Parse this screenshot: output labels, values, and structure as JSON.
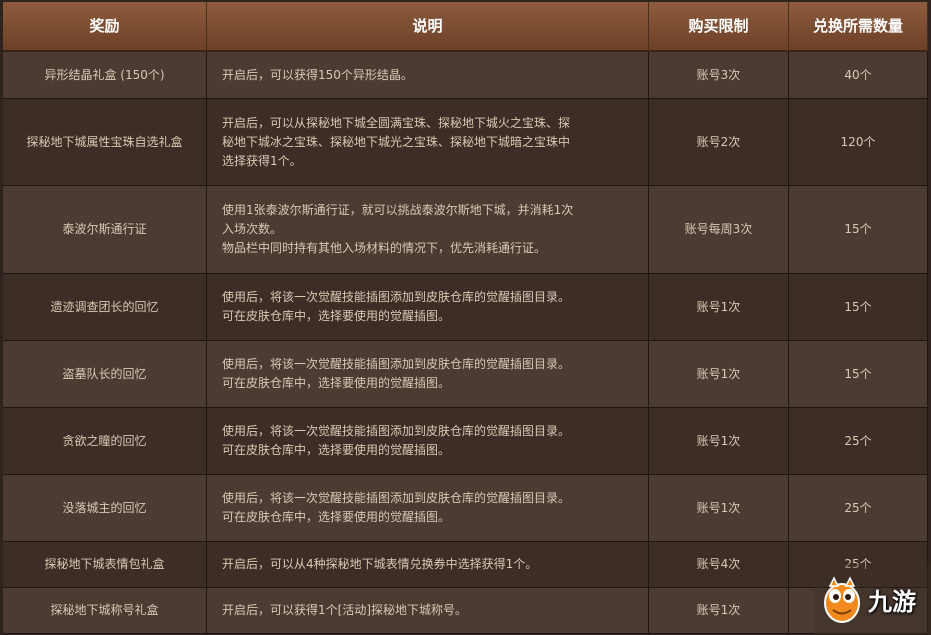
{
  "header": {
    "reward": "奖励",
    "description": "说明",
    "limit": "购买限制",
    "cost": "兑换所需数量"
  },
  "rows": [
    {
      "reward": "异形结晶礼盒 (150个)",
      "desc": [
        "开启后，可以获得150个异形结晶。"
      ],
      "limit": "账号3次",
      "cost": "40个"
    },
    {
      "reward": "探秘地下城属性宝珠自选礼盒",
      "desc": [
        "开启后，可以从探秘地下城全圆满宝珠、探秘地下城火之宝珠、探",
        "秘地下城冰之宝珠、探秘地下城光之宝珠、探秘地下城暗之宝珠中",
        "选择获得1个。"
      ],
      "limit": "账号2次",
      "cost": "120个"
    },
    {
      "reward": "泰波尔斯通行证",
      "desc": [
        "使用1张泰波尔斯通行证，就可以挑战泰波尔斯地下城，并消耗1次",
        "入场次数。",
        "物品栏中同时持有其他入场材料的情况下，优先消耗通行证。"
      ],
      "limit": "账号每周3次",
      "cost": "15个"
    },
    {
      "reward": "遗迹调查团长的回忆",
      "desc": [
        "使用后，将该一次觉醒技能插图添加到皮肤仓库的觉醒插图目录。",
        "可在皮肤仓库中，选择要使用的觉醒插图。"
      ],
      "limit": "账号1次",
      "cost": "15个"
    },
    {
      "reward": "盗墓队长的回忆",
      "desc": [
        "使用后，将该一次觉醒技能插图添加到皮肤仓库的觉醒插图目录。",
        "可在皮肤仓库中，选择要使用的觉醒插图。"
      ],
      "limit": "账号1次",
      "cost": "15个"
    },
    {
      "reward": "贪欲之瞳的回忆",
      "desc": [
        "使用后，将该一次觉醒技能插图添加到皮肤仓库的觉醒插图目录。",
        "可在皮肤仓库中，选择要使用的觉醒插图。"
      ],
      "limit": "账号1次",
      "cost": "25个"
    },
    {
      "reward": "没落城主的回忆",
      "desc": [
        "使用后，将该一次觉醒技能插图添加到皮肤仓库的觉醒插图目录。",
        "可在皮肤仓库中，选择要使用的觉醒插图。"
      ],
      "limit": "账号1次",
      "cost": "25个"
    },
    {
      "reward": "探秘地下城表情包礼盒",
      "desc": [
        "开启后，可以从4种探秘地下城表情兑换券中选择获得1个。"
      ],
      "limit": "账号4次",
      "cost": "25个"
    },
    {
      "reward": "探秘地下城称号礼盒",
      "desc": [
        "开启后，可以获得1个[活动]探秘地下城称号。"
      ],
      "limit": "账号1次",
      "cost": ""
    }
  ],
  "watermark": {
    "text": "九游",
    "icon": "mascot-icon",
    "color": "#f08a1c"
  },
  "colors": {
    "header_bg": "#7a4a2f",
    "row_odd": "#4b3b32",
    "row_even": "#3c2e26",
    "text": "#d9c8b4"
  }
}
